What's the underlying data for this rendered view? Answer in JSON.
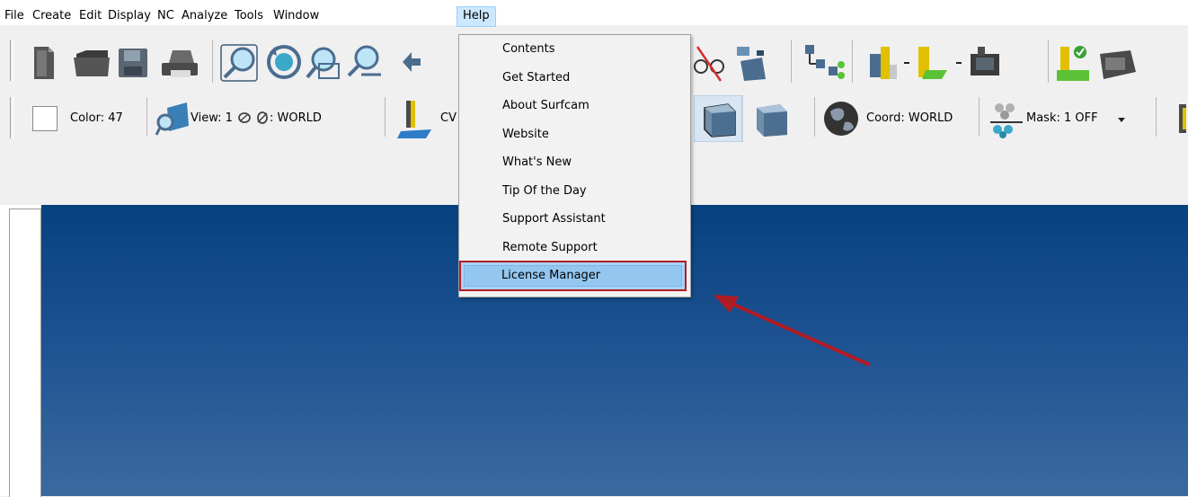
{
  "menubar": {
    "items": [
      "File",
      "Create",
      "Edit",
      "Display",
      "NC",
      "Analyze",
      "Tools",
      "Window",
      "Help"
    ]
  },
  "toolbar2": {
    "color_label": "Color: 47",
    "view_label": "View: 1",
    "world_label": ": WORLD",
    "cv_label": "CV",
    "coord_label": "Coord: WORLD",
    "mask_label": "Mask:  1 OFF"
  },
  "help_menu": {
    "items": [
      "Contents",
      "Get Started",
      "About Surfcam",
      "Website",
      "What's New",
      "Tip Of the Day",
      "Support Assistant",
      "Remote Support",
      "License Manager"
    ]
  },
  "colors": {
    "viewport_top": "#08417f",
    "viewport_bottom": "#3b6a9f",
    "highlight": "#94c7f0",
    "callout_red": "#b01c24"
  },
  "icons": [
    "new-file-icon",
    "open-folder-icon",
    "save-icon",
    "print-icon",
    "zoom-window-icon",
    "rotate-view-icon",
    "zoom-fit-icon",
    "zoom-out-icon",
    "pan-icon",
    "hide-icon",
    "layers-icon",
    "tree-icon",
    "tool-icon",
    "lathe-tool-icon",
    "fixture-icon",
    "verify-icon",
    "machine-icon",
    "shaded-cube-icon",
    "solid-cube-icon",
    "globe-icon",
    "mask-icon"
  ]
}
